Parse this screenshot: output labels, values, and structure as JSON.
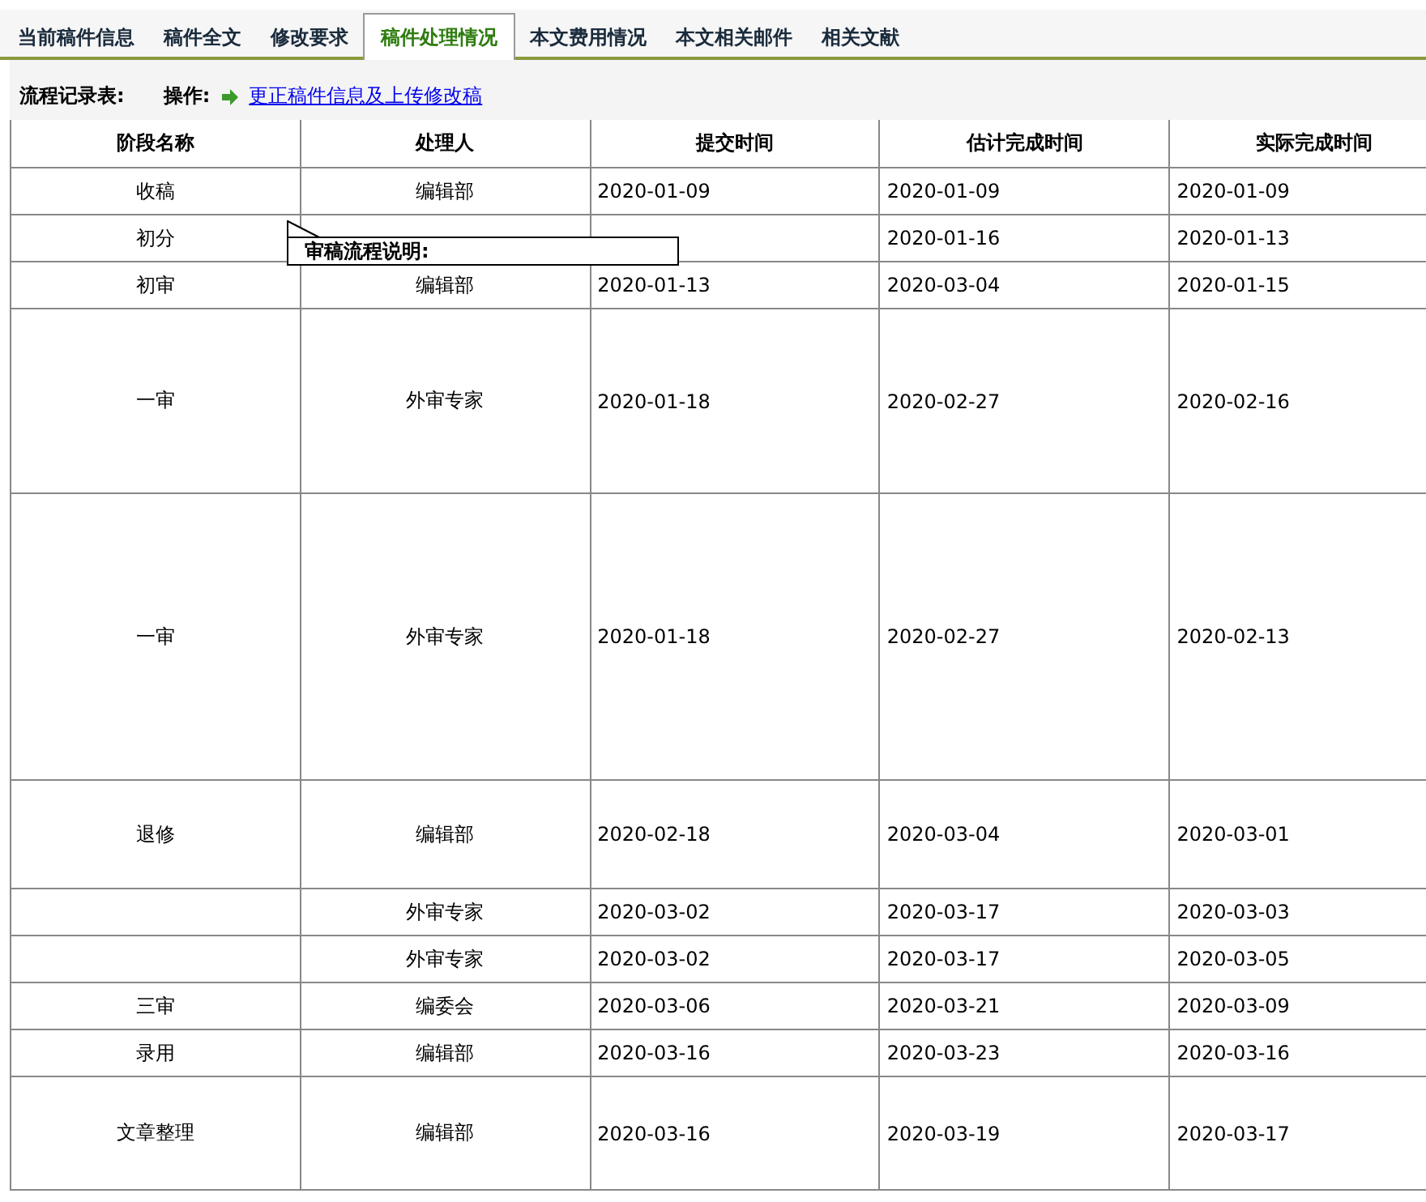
{
  "tabs": [
    {
      "label": "当前稿件信息",
      "selected": false
    },
    {
      "label": "稿件全文",
      "selected": false
    },
    {
      "label": "修改要求",
      "selected": false
    },
    {
      "label": "稿件处理情况",
      "selected": true
    },
    {
      "label": "本文费用情况",
      "selected": false
    },
    {
      "label": "本文相关邮件",
      "selected": false
    },
    {
      "label": "相关文献",
      "selected": false
    }
  ],
  "section_label": "流程记录表:",
  "action_label": "操作:",
  "action_link": "更正稿件信息及上传修改稿",
  "table": {
    "columns": [
      "阶段名称",
      "处理人",
      "提交时间",
      "估计完成时间",
      "实际完成时间"
    ],
    "rows": [
      [
        "收稿",
        "编辑部",
        "2020-01-09",
        "2020-01-09",
        "2020-01-09"
      ],
      [
        "初分",
        "",
        "",
        "2020-01-16",
        "2020-01-13"
      ],
      [
        "初审",
        "编辑部",
        "2020-01-13",
        "2020-03-04",
        "2020-01-15"
      ],
      [
        "一审",
        "外审专家",
        "2020-01-18",
        "2020-02-27",
        "2020-02-16"
      ],
      [
        "一审",
        "外审专家",
        "2020-01-18",
        "2020-02-27",
        "2020-02-13"
      ],
      [
        "退修",
        "编辑部",
        "2020-02-18",
        "2020-03-04",
        "2020-03-01"
      ],
      [
        "",
        "外审专家",
        "2020-03-02",
        "2020-03-17",
        "2020-03-03"
      ],
      [
        "",
        "外审专家",
        "2020-03-02",
        "2020-03-17",
        "2020-03-05"
      ],
      [
        "三审",
        "编委会",
        "2020-03-06",
        "2020-03-21",
        "2020-03-09"
      ],
      [
        "录用",
        "编辑部",
        "2020-03-16",
        "2020-03-23",
        "2020-03-16"
      ],
      [
        "文章整理",
        "编辑部",
        "2020-03-16",
        "2020-03-19",
        "2020-03-17"
      ]
    ]
  },
  "tooltip": "审稿流程说明:"
}
